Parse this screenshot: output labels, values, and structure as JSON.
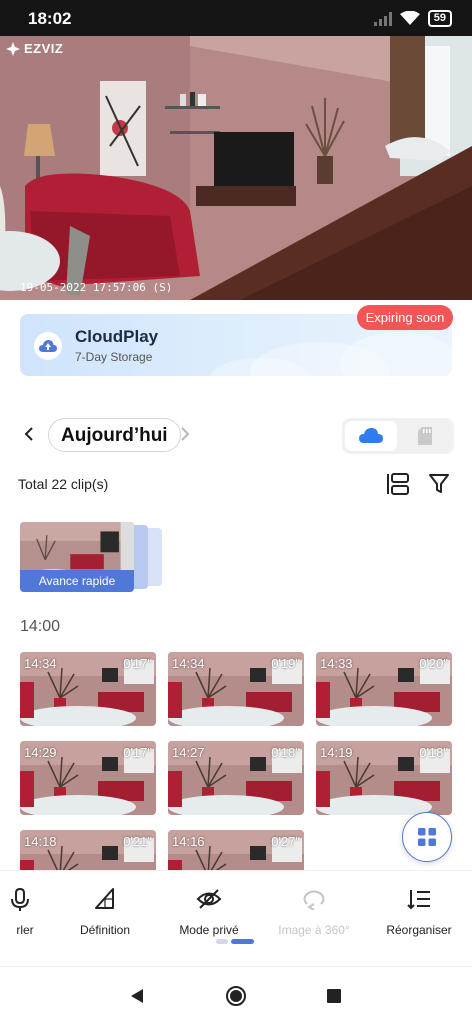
{
  "status_bar": {
    "time": "18:02",
    "battery": "59"
  },
  "camera": {
    "brand": "EZVIZ",
    "timestamp": "19-05-2022 17:57:06  (S)"
  },
  "cloud_banner": {
    "title": "CloudPlay",
    "subtitle": "7-Day Storage",
    "badge": "Expiring soon"
  },
  "date_nav": {
    "label": "Aujourd’hui"
  },
  "total_label": "Total 22 clip(s)",
  "fast_forward": {
    "label": "Avance rapide"
  },
  "section_time": "14:00",
  "clips": [
    {
      "time": "14:34",
      "duration": "0'17\""
    },
    {
      "time": "14:34",
      "duration": "0'19\""
    },
    {
      "time": "14:33",
      "duration": "0'20\""
    },
    {
      "time": "14:29",
      "duration": "0'17\""
    },
    {
      "time": "14:27",
      "duration": "0'18\""
    },
    {
      "time": "14:19",
      "duration": "0'18\""
    },
    {
      "time": "14:18",
      "duration": "0'21\""
    },
    {
      "time": "14:16",
      "duration": "0'27\""
    }
  ],
  "toolbar": [
    {
      "label": "rler",
      "icon": "microphone-icon",
      "disabled": false
    },
    {
      "label": "Définition",
      "icon": "definition-icon",
      "disabled": false
    },
    {
      "label": "Mode privé",
      "icon": "eye-off-icon",
      "disabled": false
    },
    {
      "label": "Image à 360°",
      "icon": "rotate-360-icon",
      "disabled": true
    },
    {
      "label": "Réorganiser",
      "icon": "reorder-icon",
      "disabled": false
    }
  ],
  "colors": {
    "accent": "#4f78d8",
    "badge": "#f25555",
    "status_bar": "#151515"
  }
}
